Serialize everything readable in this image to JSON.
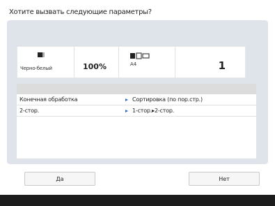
{
  "dialog": {
    "prompt": "Хотите вызвать следующие параметры?"
  },
  "settings": {
    "color_mode": "Черно-белый",
    "color_icon": "bw-color-icon",
    "zoom": "100%",
    "paper_icon": "paper-tray-icon",
    "paper_size": "A4",
    "copies": "1"
  },
  "details": {
    "rows": [
      {
        "label": "Конечная обработка",
        "value": "Сортировка (по пор.стр.)"
      },
      {
        "label": "2-стор.",
        "value": "1-стор.▸2-стор."
      }
    ]
  },
  "buttons": {
    "yes": "Да",
    "no": "Нет"
  },
  "colors": {
    "panel": "#dfe3ea",
    "arrow": "#2a6fc9"
  }
}
